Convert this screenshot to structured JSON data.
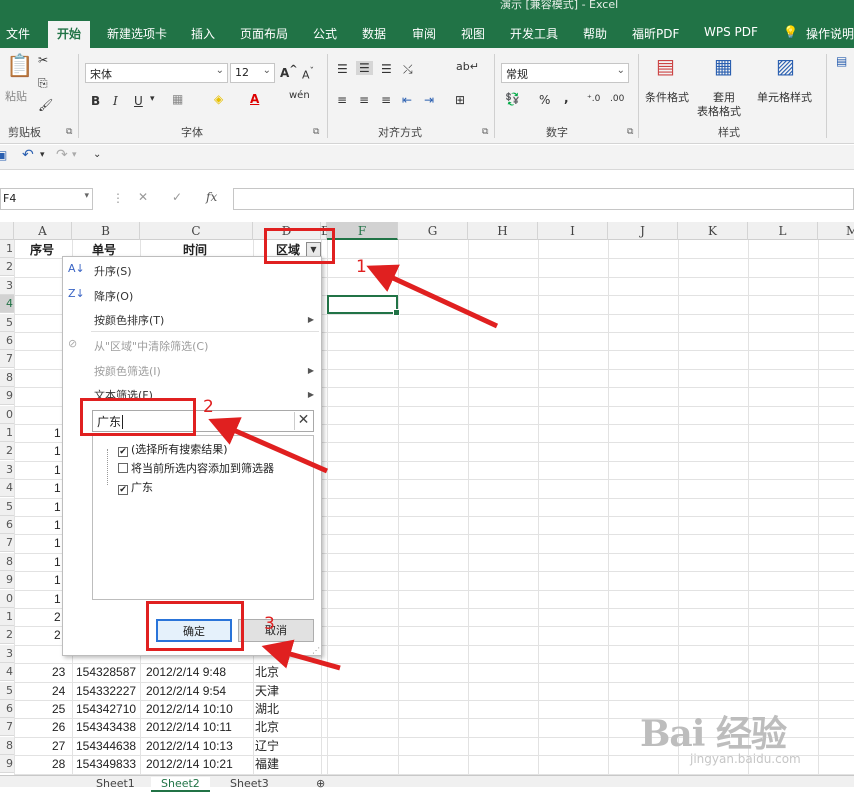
{
  "window": {
    "title": "演示 [兼容模式] - Excel"
  },
  "ribbon_tabs": [
    "文件",
    "开始",
    "新建选项卡",
    "插入",
    "页面布局",
    "公式",
    "数据",
    "审阅",
    "视图",
    "开发工具",
    "帮助",
    "福昕PDF",
    "WPS PDF",
    "操作说明"
  ],
  "active_tab": "开始",
  "ribbon": {
    "clipboard": {
      "paste": "粘贴",
      "label": "剪贴板"
    },
    "font": {
      "name": "宋体",
      "size": "12",
      "grow": "A",
      "shrink": "A",
      "bold": "B",
      "italic": "I",
      "underline": "U",
      "phonetic": "wén",
      "label": "字体"
    },
    "alignment": {
      "label": "对齐方式"
    },
    "number": {
      "format": "常规",
      "percent": "%",
      "comma": ",",
      "label": "数字"
    },
    "styles": {
      "conditional": "条件格式",
      "table_line1": "套用",
      "table_line2": "表格格式",
      "cell_styles": "单元格样式",
      "label": "样式"
    }
  },
  "name_box": "F4",
  "fx": "fx",
  "columns": [
    "A",
    "B",
    "C",
    "D",
    "E",
    "F",
    "G",
    "H",
    "I",
    "J",
    "K",
    "L",
    "M"
  ],
  "header_row": {
    "a": "序号",
    "b": "单号",
    "c": "时间",
    "d": "区域"
  },
  "partial_a_values": [
    "1",
    "1",
    "1",
    "1",
    "1",
    "1",
    "1",
    "1",
    "1",
    "1",
    "2",
    "2"
  ],
  "data_rows": [
    {
      "a": "23",
      "b": "154328587",
      "c": "2012/2/14 9:48",
      "d": "北京"
    },
    {
      "a": "24",
      "b": "154332227",
      "c": "2012/2/14 9:54",
      "d": "天津"
    },
    {
      "a": "25",
      "b": "154342710",
      "c": "2012/2/14 10:10",
      "d": "湖北"
    },
    {
      "a": "26",
      "b": "154343438",
      "c": "2012/2/14 10:11",
      "d": "北京"
    },
    {
      "a": "27",
      "b": "154344638",
      "c": "2012/2/14 10:13",
      "d": "辽宁"
    },
    {
      "a": "28",
      "b": "154349833",
      "c": "2012/2/14 10:21",
      "d": "福建"
    }
  ],
  "filter_menu": {
    "sort_asc": "升序(S)",
    "sort_desc": "降序(O)",
    "sort_color": "按颜色排序(T)",
    "clear_filter": "从\"区域\"中清除筛选(C)",
    "filter_color": "按颜色筛选(I)",
    "text_filter": "文本筛选(F)",
    "search_value": "广东",
    "options": [
      {
        "label": "(选择所有搜索结果)",
        "checked": true
      },
      {
        "label": "将当前所选内容添加到筛选器",
        "checked": false
      },
      {
        "label": "广东",
        "checked": true
      }
    ],
    "ok": "确定",
    "cancel": "取消"
  },
  "annotations": [
    "1",
    "2",
    "3"
  ],
  "sheets": [
    "Sheet1",
    "Sheet2",
    "Sheet3"
  ],
  "active_sheet": "Sheet2",
  "watermark": {
    "main": "Bai 经验",
    "sub": "jingyan.baidu.com"
  },
  "colors": {
    "excel_green": "#217346",
    "annotation_red": "#e02020"
  }
}
